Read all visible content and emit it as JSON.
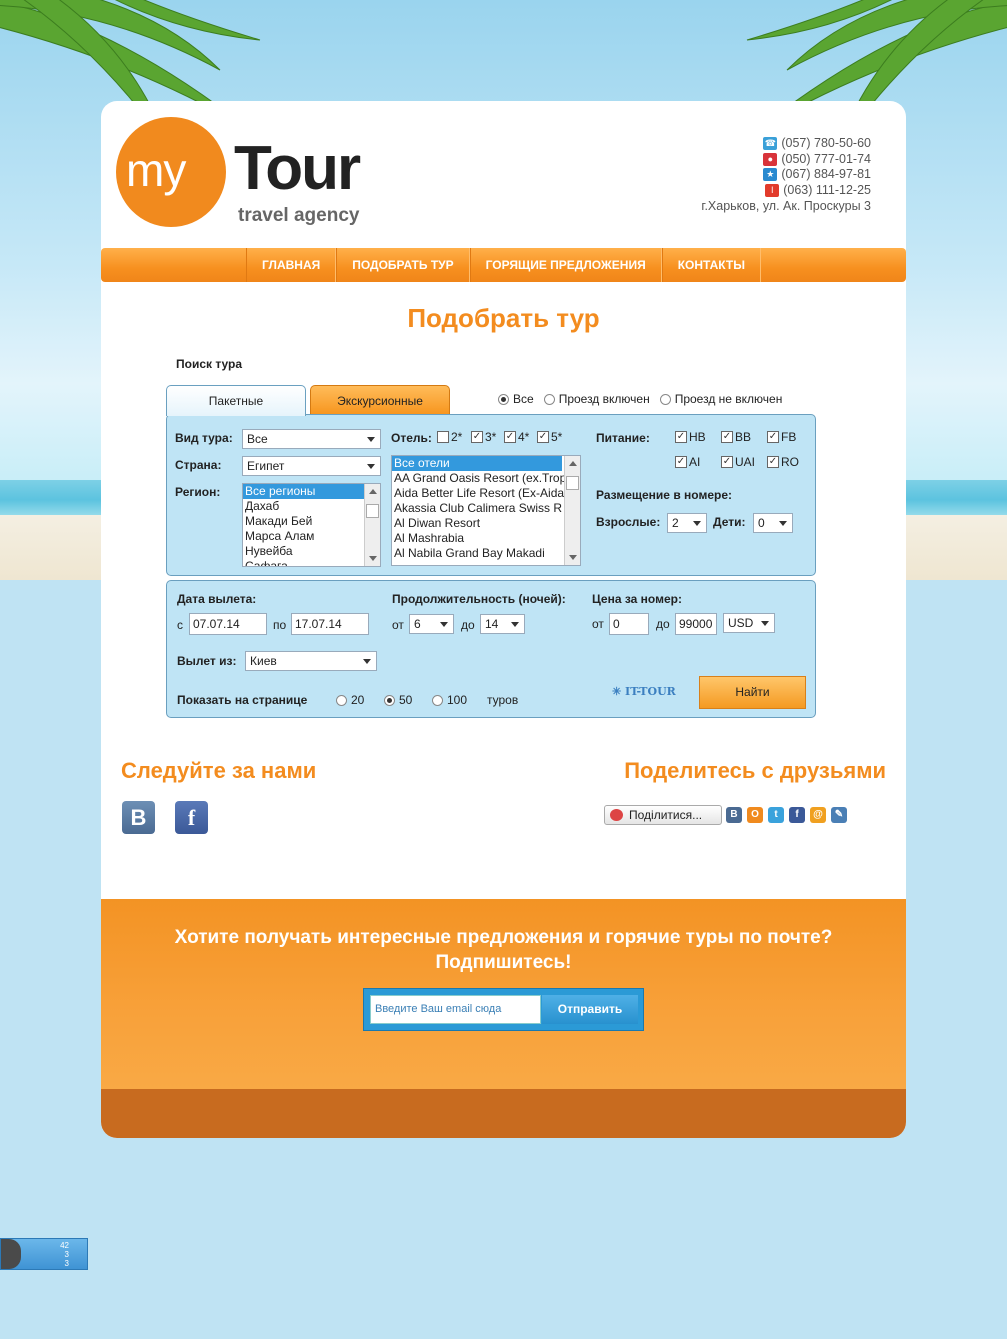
{
  "logo": {
    "my": "my",
    "tour": "Tour",
    "sub": "travel agency"
  },
  "contacts": {
    "phones": [
      {
        "icon": "phone-icon",
        "color": "#3aa0d8",
        "number": "(057) 780-50-60"
      },
      {
        "icon": "kyivstar-icon",
        "color": "#d8333a",
        "number": "(050) 777-01-74"
      },
      {
        "icon": "star-icon",
        "color": "#2a8ad0",
        "number": "(067) 884-97-81"
      },
      {
        "icon": "life-icon",
        "color": "#e23b2b",
        "number": "(063) 111-12-25"
      }
    ],
    "address": "г.Харьков, ул. Ак. Проскуры 3"
  },
  "nav": [
    "ГЛАВНАЯ",
    "ПОДОБРАТЬ ТУР",
    "ГОРЯЩИЕ ПРЕДЛОЖЕНИЯ",
    "КОНТАКТЫ"
  ],
  "page_title": "Подобрать тур",
  "search": {
    "label": "Поиск тура",
    "tabs": [
      "Пакетные",
      "Экскурсионные"
    ],
    "transport": {
      "options": [
        "Все",
        "Проезд включен",
        "Проезд не включен"
      ],
      "selected": "Все"
    },
    "tour_type": {
      "label": "Вид тура:",
      "value": "Все"
    },
    "country": {
      "label": "Страна:",
      "value": "Египет"
    },
    "region": {
      "label": "Регион:",
      "items": [
        "Все регионы",
        "Дахаб",
        "Макади Бей",
        "Марса Алам",
        "Нувейба",
        "Сафага"
      ]
    },
    "hotel": {
      "label": "Отель:",
      "stars": [
        {
          "label": "2*",
          "checked": false
        },
        {
          "label": "3*",
          "checked": true
        },
        {
          "label": "4*",
          "checked": true
        },
        {
          "label": "5*",
          "checked": true
        }
      ],
      "items": [
        "Все отели",
        "AA Grand Oasis Resort (ex.Tropi",
        "Aida Better Life Resort (Ex-Aida",
        "Akassia Club Calimera Swiss R",
        "Al Diwan Resort",
        "Al Mashrabia",
        "Al Nabila Grand Bay Makadi"
      ]
    },
    "meals": {
      "label": "Питание:",
      "options": [
        {
          "label": "HB",
          "checked": true
        },
        {
          "label": "BB",
          "checked": true
        },
        {
          "label": "FB",
          "checked": true
        },
        {
          "label": "AI",
          "checked": true
        },
        {
          "label": "UAI",
          "checked": true
        },
        {
          "label": "RO",
          "checked": true
        }
      ]
    },
    "room": {
      "label": "Размещение в номере:",
      "adults_label": "Взрослые:",
      "adults": "2",
      "kids_label": "Дети:",
      "kids": "0"
    },
    "departure": {
      "label": "Дата вылета:",
      "from_label": "с",
      "from": "07.07.14",
      "to_label": "по",
      "to": "17.07.14"
    },
    "duration": {
      "label": "Продолжительность (ночей):",
      "from_label": "от",
      "from": "6",
      "to_label": "до",
      "to": "14"
    },
    "price": {
      "label": "Цена за номер:",
      "from_label": "от",
      "from": "0",
      "to_label": "до",
      "to": "99000",
      "currency": "USD"
    },
    "city": {
      "label": "Вылет из:",
      "value": "Киев"
    },
    "per_page": {
      "label": "Показать на странице",
      "options": [
        "20",
        "50",
        "100"
      ],
      "selected": "50",
      "suffix": "туров"
    },
    "provider": "IT-TOUR",
    "find_button": "Найти"
  },
  "social": {
    "follow_title": "Следуйте за нами",
    "share_title": "Поделитесь с друзьями",
    "share_button": "Поділитися...",
    "mini_icons": [
      {
        "name": "vk",
        "letter": "В",
        "color": "#4a6a92"
      },
      {
        "name": "odnoklassniki",
        "letter": "O",
        "color": "#f08a1e"
      },
      {
        "name": "twitter",
        "letter": "t",
        "color": "#3aa2dc"
      },
      {
        "name": "facebook",
        "letter": "f",
        "color": "#3b5998"
      },
      {
        "name": "mail",
        "letter": "@",
        "color": "#f0a020"
      },
      {
        "name": "livejournal",
        "letter": "✎",
        "color": "#4a7fb5"
      }
    ]
  },
  "subscribe": {
    "title_line1": "Хотите получать интересные предложения и горячие туры по почте?",
    "title_line2": "Подпишитесь!",
    "placeholder": "Введите Ваш email сюда",
    "button": "Отправить"
  },
  "counter": {
    "values": [
      "42",
      "3",
      "3"
    ]
  }
}
